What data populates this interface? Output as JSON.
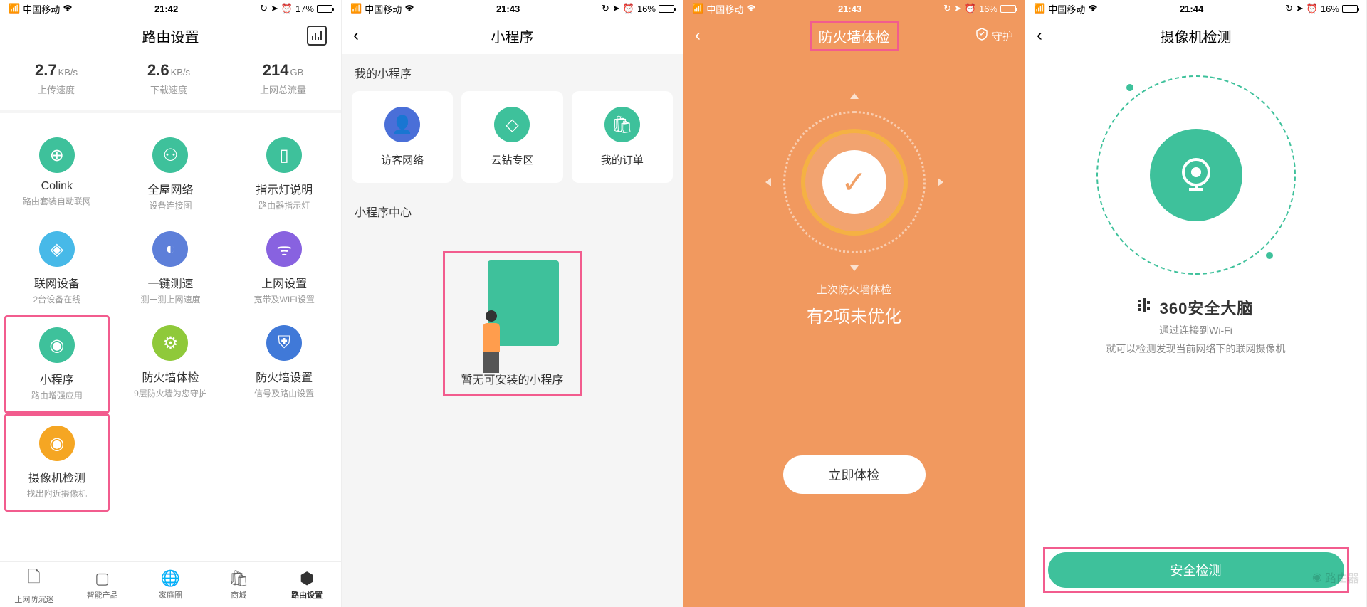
{
  "s1": {
    "status": {
      "carrier": "中国移动",
      "time": "21:42",
      "battery": "17%"
    },
    "title": "路由设置",
    "stats": [
      {
        "value": "2.7",
        "unit": "KB/s",
        "label": "上传速度"
      },
      {
        "value": "2.6",
        "unit": "KB/s",
        "label": "下载速度"
      },
      {
        "value": "214",
        "unit": "GB",
        "label": "上网总流量"
      }
    ],
    "grid": [
      {
        "title": "Colink",
        "sub": "路由套装自动联网",
        "color": "#3ec19b"
      },
      {
        "title": "全屋网络",
        "sub": "设备连接图",
        "color": "#3ec19b"
      },
      {
        "title": "指示灯说明",
        "sub": "路由器指示灯",
        "color": "#3ec19b"
      },
      {
        "title": "联网设备",
        "sub": "2台设备在线",
        "color": "#47b9e8"
      },
      {
        "title": "一键测速",
        "sub": "测一测上网速度",
        "color": "#5d7fd9"
      },
      {
        "title": "上网设置",
        "sub": "宽带及WIFI设置",
        "color": "#8862e0"
      },
      {
        "title": "小程序",
        "sub": "路由增强应用",
        "color": "#3ec19b",
        "hl": true
      },
      {
        "title": "防火墙体检",
        "sub": "9层防火墙为您守护",
        "color": "#8fc93a"
      },
      {
        "title": "防火墙设置",
        "sub": "信号及路由设置",
        "color": "#4079d8"
      },
      {
        "title": "摄像机检测",
        "sub": "找出附近摄像机",
        "color": "#f5a623",
        "hl": true
      }
    ],
    "tabs": [
      {
        "label": "上网防沉迷"
      },
      {
        "label": "智能产品"
      },
      {
        "label": "家庭圈"
      },
      {
        "label": "商城"
      },
      {
        "label": "路由设置",
        "active": true
      }
    ]
  },
  "s2": {
    "status": {
      "carrier": "中国移动",
      "time": "21:43",
      "battery": "16%"
    },
    "title": "小程序",
    "section1": "我的小程序",
    "cards": [
      {
        "label": "访客网络",
        "color": "#4a6fd8"
      },
      {
        "label": "云钻专区",
        "color": "#3ec19b"
      },
      {
        "label": "我的订单",
        "color": "#3ec19b"
      }
    ],
    "section2": "小程序中心",
    "empty": "暂无可安装的小程序"
  },
  "s3": {
    "status": {
      "carrier": "中国移动",
      "time": "21:43",
      "battery": "16%"
    },
    "title": "防火墙体检",
    "guard": "守护",
    "sub": "上次防火墙体检",
    "main": "有2项未优化",
    "btn": "立即体检"
  },
  "s4": {
    "status": {
      "carrier": "中国移动",
      "time": "21:44",
      "battery": "16%"
    },
    "title": "摄像机检测",
    "brand": "360安全大脑",
    "line1": "通过连接到Wi-Fi",
    "line2": "就可以检测发现当前网络下的联网摄像机",
    "btn": "安全检测",
    "wm": "路由器"
  }
}
